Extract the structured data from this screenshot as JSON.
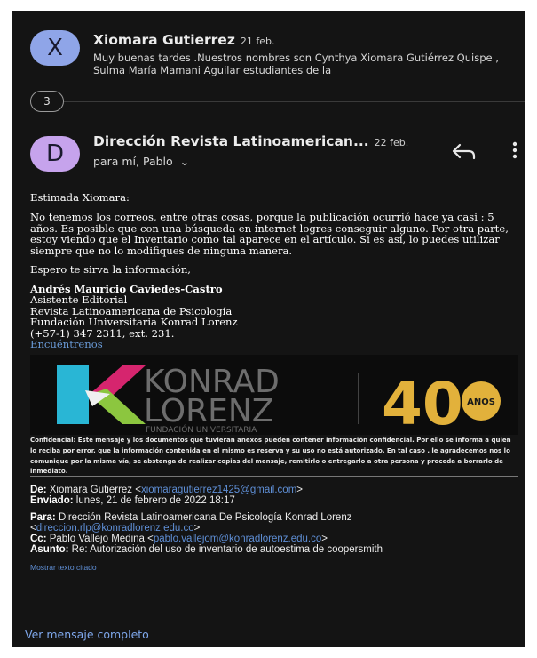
{
  "thread": {
    "first_message": {
      "avatar_letter": "X",
      "sender": "Xiomara Gutierrez",
      "date": "21 feb.",
      "snippet": "Muy buenas tardes .Nuestros nombres son Cynthya Xiomara Gutiérrez Quispe , Sulma María Mamani Aguilar estudiantes de la"
    },
    "collapsed_count": "3",
    "open_message": {
      "avatar_letter": "D",
      "sender": "Dirección Revista Latinoamerican...",
      "date": "22 feb.",
      "recipients": "para mí, Pablo",
      "recipients_chevron": "⌄"
    }
  },
  "body": {
    "greeting": "Estimada Xiomara:",
    "paragraph1": "No tenemos los correos, entre otras cosas, porque la publicación ocurrió hace ya casi : 5 años. Es posible que con una búsqueda en internet logres conseguir alguno. Por otra parte, estoy viendo que el Inventario como tal aparece en el artículo. Si es así, lo puedes utilizar siempre que no lo modifiques de ninguna manera.",
    "closing": "Espero te sirva la información,"
  },
  "signature": {
    "name": "Andrés Mauricio Caviedes-Castro",
    "role": "Asistente Editorial",
    "publication": "Revista Latinoamericana de Psicología",
    "institution": "Fundación Universitaria Konrad Lorenz",
    "phone": "(+57-1) 347 2311, ext. 231.",
    "link": "Encuéntrenos"
  },
  "banner": {
    "logo_line1": "KONRAD",
    "logo_line2": "LORENZ",
    "logo_line3": "FUNDACIÓN UNIVERSITARIA",
    "anniversary": "40",
    "anniversary_badge": "AÑOS"
  },
  "confidential_notice": "Confidencial: Este mensaje y los documentos que tuvieran anexos pueden contener información confidencial. Por ello se informa a quien lo reciba por error, que la información contenida en el mismo es reserva y su uso no está autorizado. En tal caso , le agradecemos nos lo comunique por la misma vía, se abstenga de realizar copias del mensaje, remitirlo o entregarlo a otra persona y proceda a borrarlo de inmediato.",
  "quoted_header": {
    "from_label": "De:",
    "from_name": "Xiomara Gutierrez",
    "from_email": "xiomaragutierrez1425@gmail.com",
    "sent_label": "Enviado:",
    "sent_value": "lunes, 21 de febrero de 2022 18:17",
    "to_label": "Para:",
    "to_name": "Dirección Revista Latinoamericana De Psicología Konrad Lorenz",
    "to_email": "direccion.rlp@konradlorenz.edu.co",
    "cc_label": "Cc:",
    "cc_name": "Pablo Vallejo Medina",
    "cc_email": "pablo.vallejom@konradlorenz.edu.co",
    "subject_label": "Asunto:",
    "subject_value": "Re: Autorización del uso de inventario de autoestima de coopersmith"
  },
  "actions": {
    "show_quoted": "Mostrar texto citado",
    "view_full": "Ver mensaje completo"
  },
  "colors": {
    "background": "#141414",
    "avatar_x": "#8fa5e8",
    "avatar_d": "#c6a3ec",
    "link": "#5f8fd6",
    "konrad_grey": "#6d6d6d",
    "konrad_cyan": "#29b6d5",
    "konrad_magenta": "#d6256e",
    "konrad_green": "#8cc63f",
    "gold": "#e2b13b"
  }
}
